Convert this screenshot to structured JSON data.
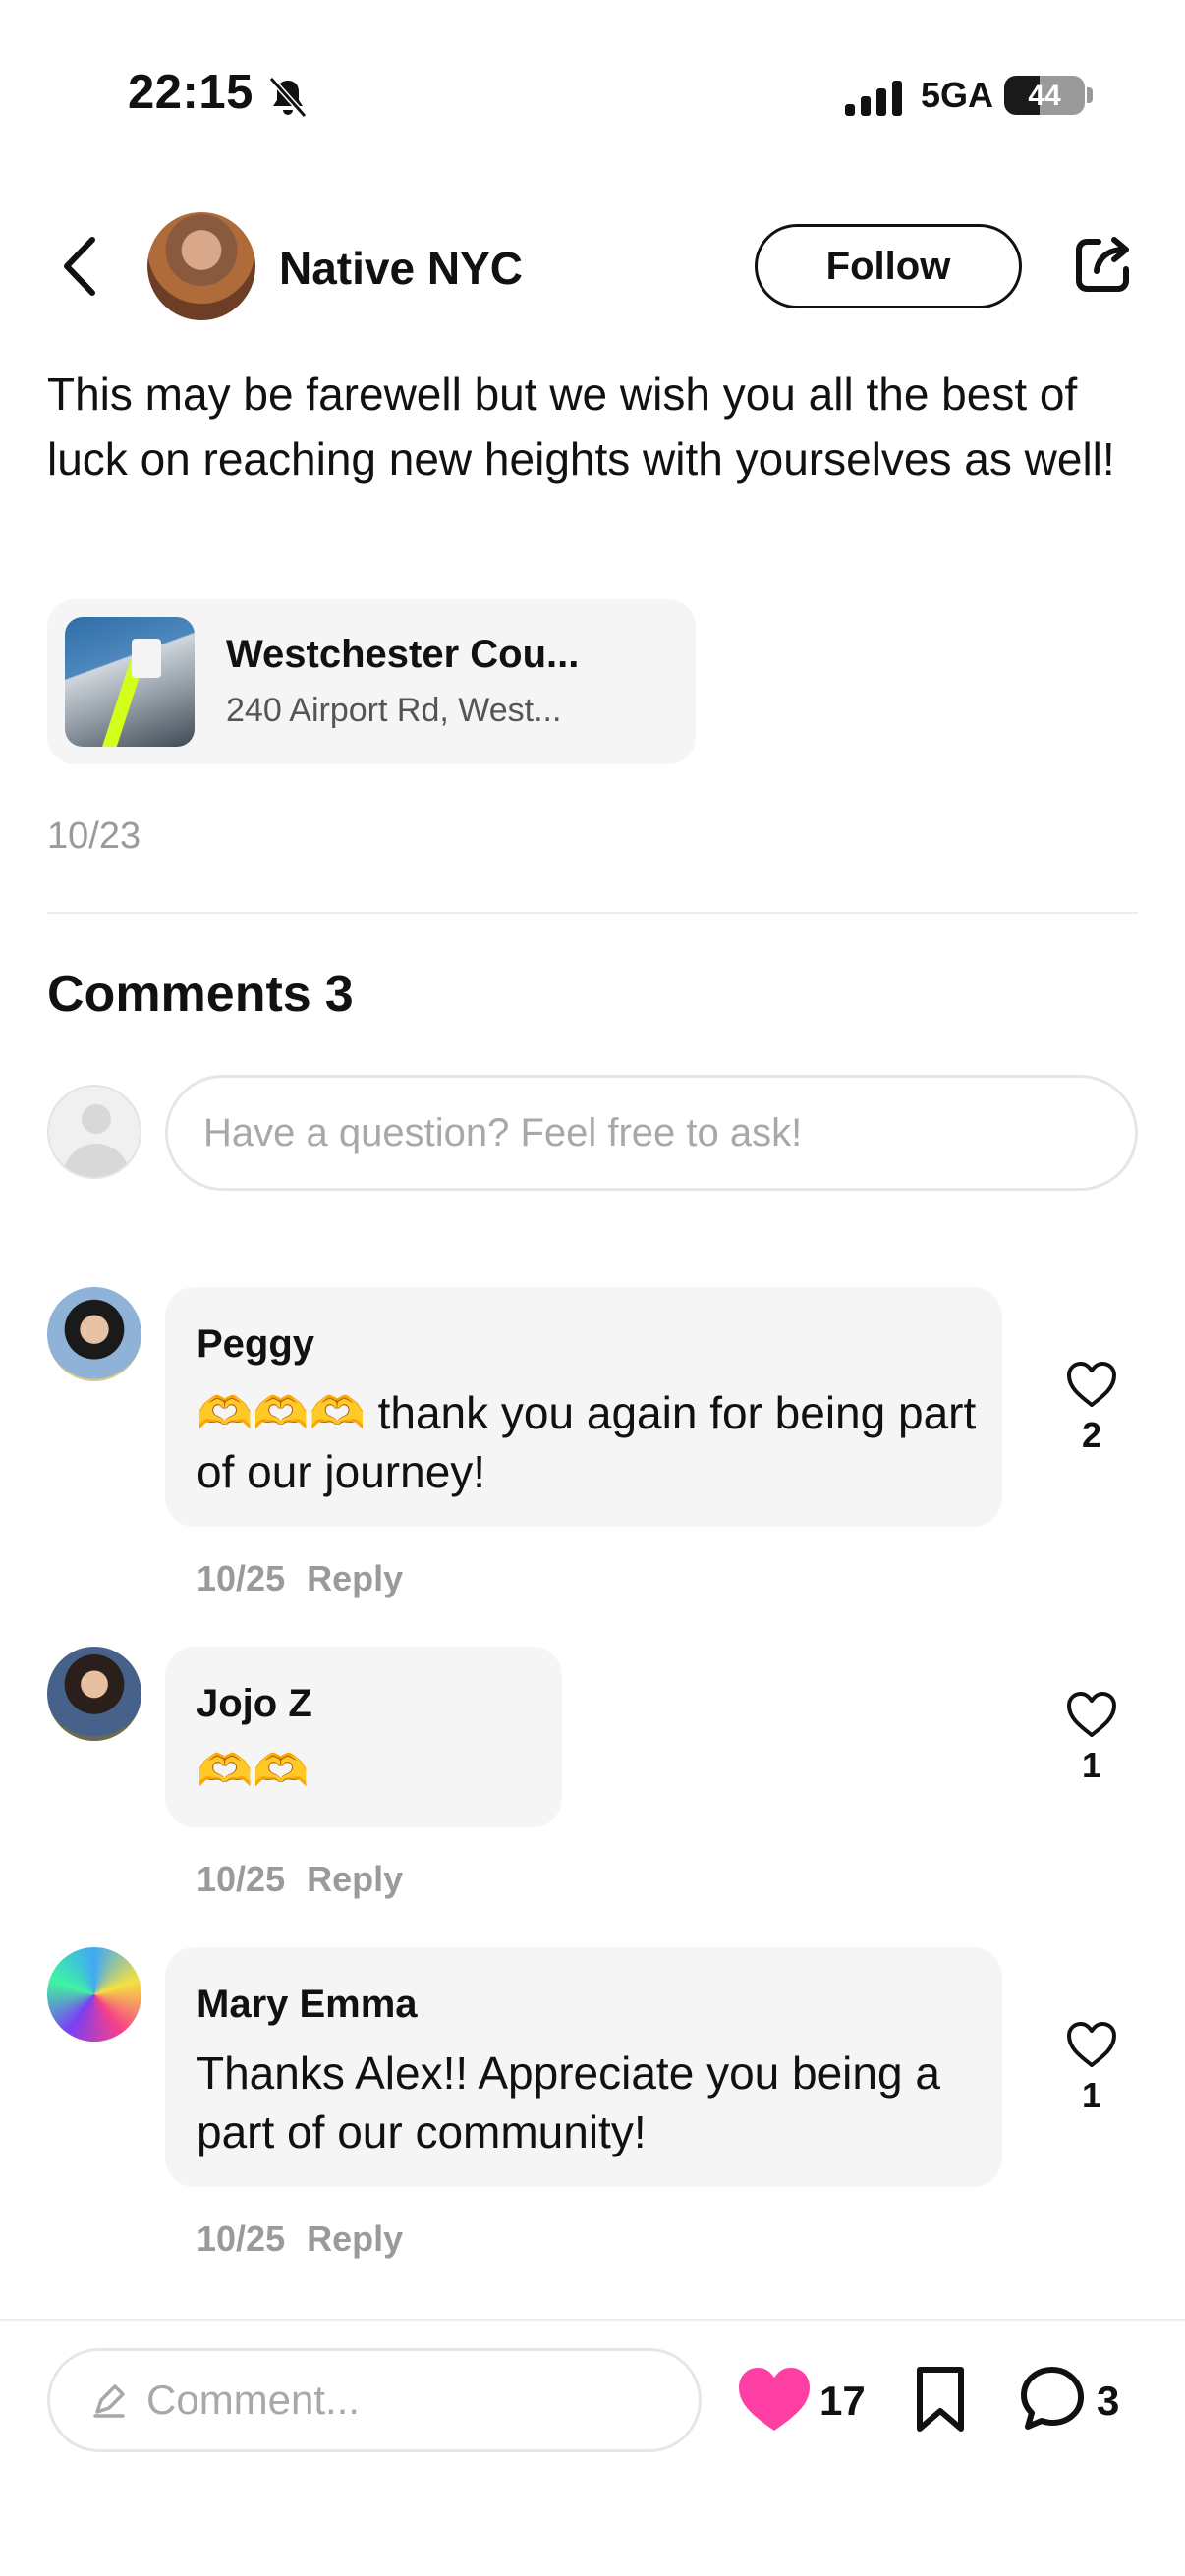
{
  "status_bar": {
    "time": "22:15",
    "network": "5GA",
    "battery": "44",
    "battery_level": 0.44
  },
  "header": {
    "author_name": "Native NYC",
    "follow_label": "Follow"
  },
  "post": {
    "text": "This may be farewell but we wish you all the best of luck on reaching new heights with yourselves as well!",
    "location": {
      "name": "Westchester Cou...",
      "address": "240 Airport Rd, West..."
    },
    "date": "10/23"
  },
  "comments_section": {
    "title": "Comments",
    "count": "3",
    "ask_placeholder": "Have a question? Feel free to ask!"
  },
  "comments": [
    {
      "name": "Peggy",
      "emoji": "🫶🫶🫶",
      "text": "thank you again for being part of our journey!",
      "date": "10/25",
      "reply_label": "Reply",
      "likes": "2"
    },
    {
      "name": "Jojo Z",
      "emoji": "🫶🫶",
      "text": "",
      "date": "10/25",
      "reply_label": "Reply",
      "likes": "1"
    },
    {
      "name": "Mary Emma",
      "text": "Thanks Alex!! Appreciate you being a part of our community!",
      "date": "10/25",
      "reply_label": "Reply",
      "likes": "1"
    }
  ],
  "bottom_bar": {
    "comment_placeholder": "Comment...",
    "like_count": "17",
    "comment_count": "3"
  },
  "colors": {
    "like": "#ff3fa4",
    "text": "#111111",
    "muted": "#9a9a9a",
    "bubble": "#f5f5f5"
  },
  "icons": [
    "bell-muted-icon",
    "signal-icon",
    "back-chevron-icon",
    "share-icon",
    "heart-icon",
    "pencil-icon",
    "bookmark-icon",
    "comment-bubble-icon"
  ]
}
